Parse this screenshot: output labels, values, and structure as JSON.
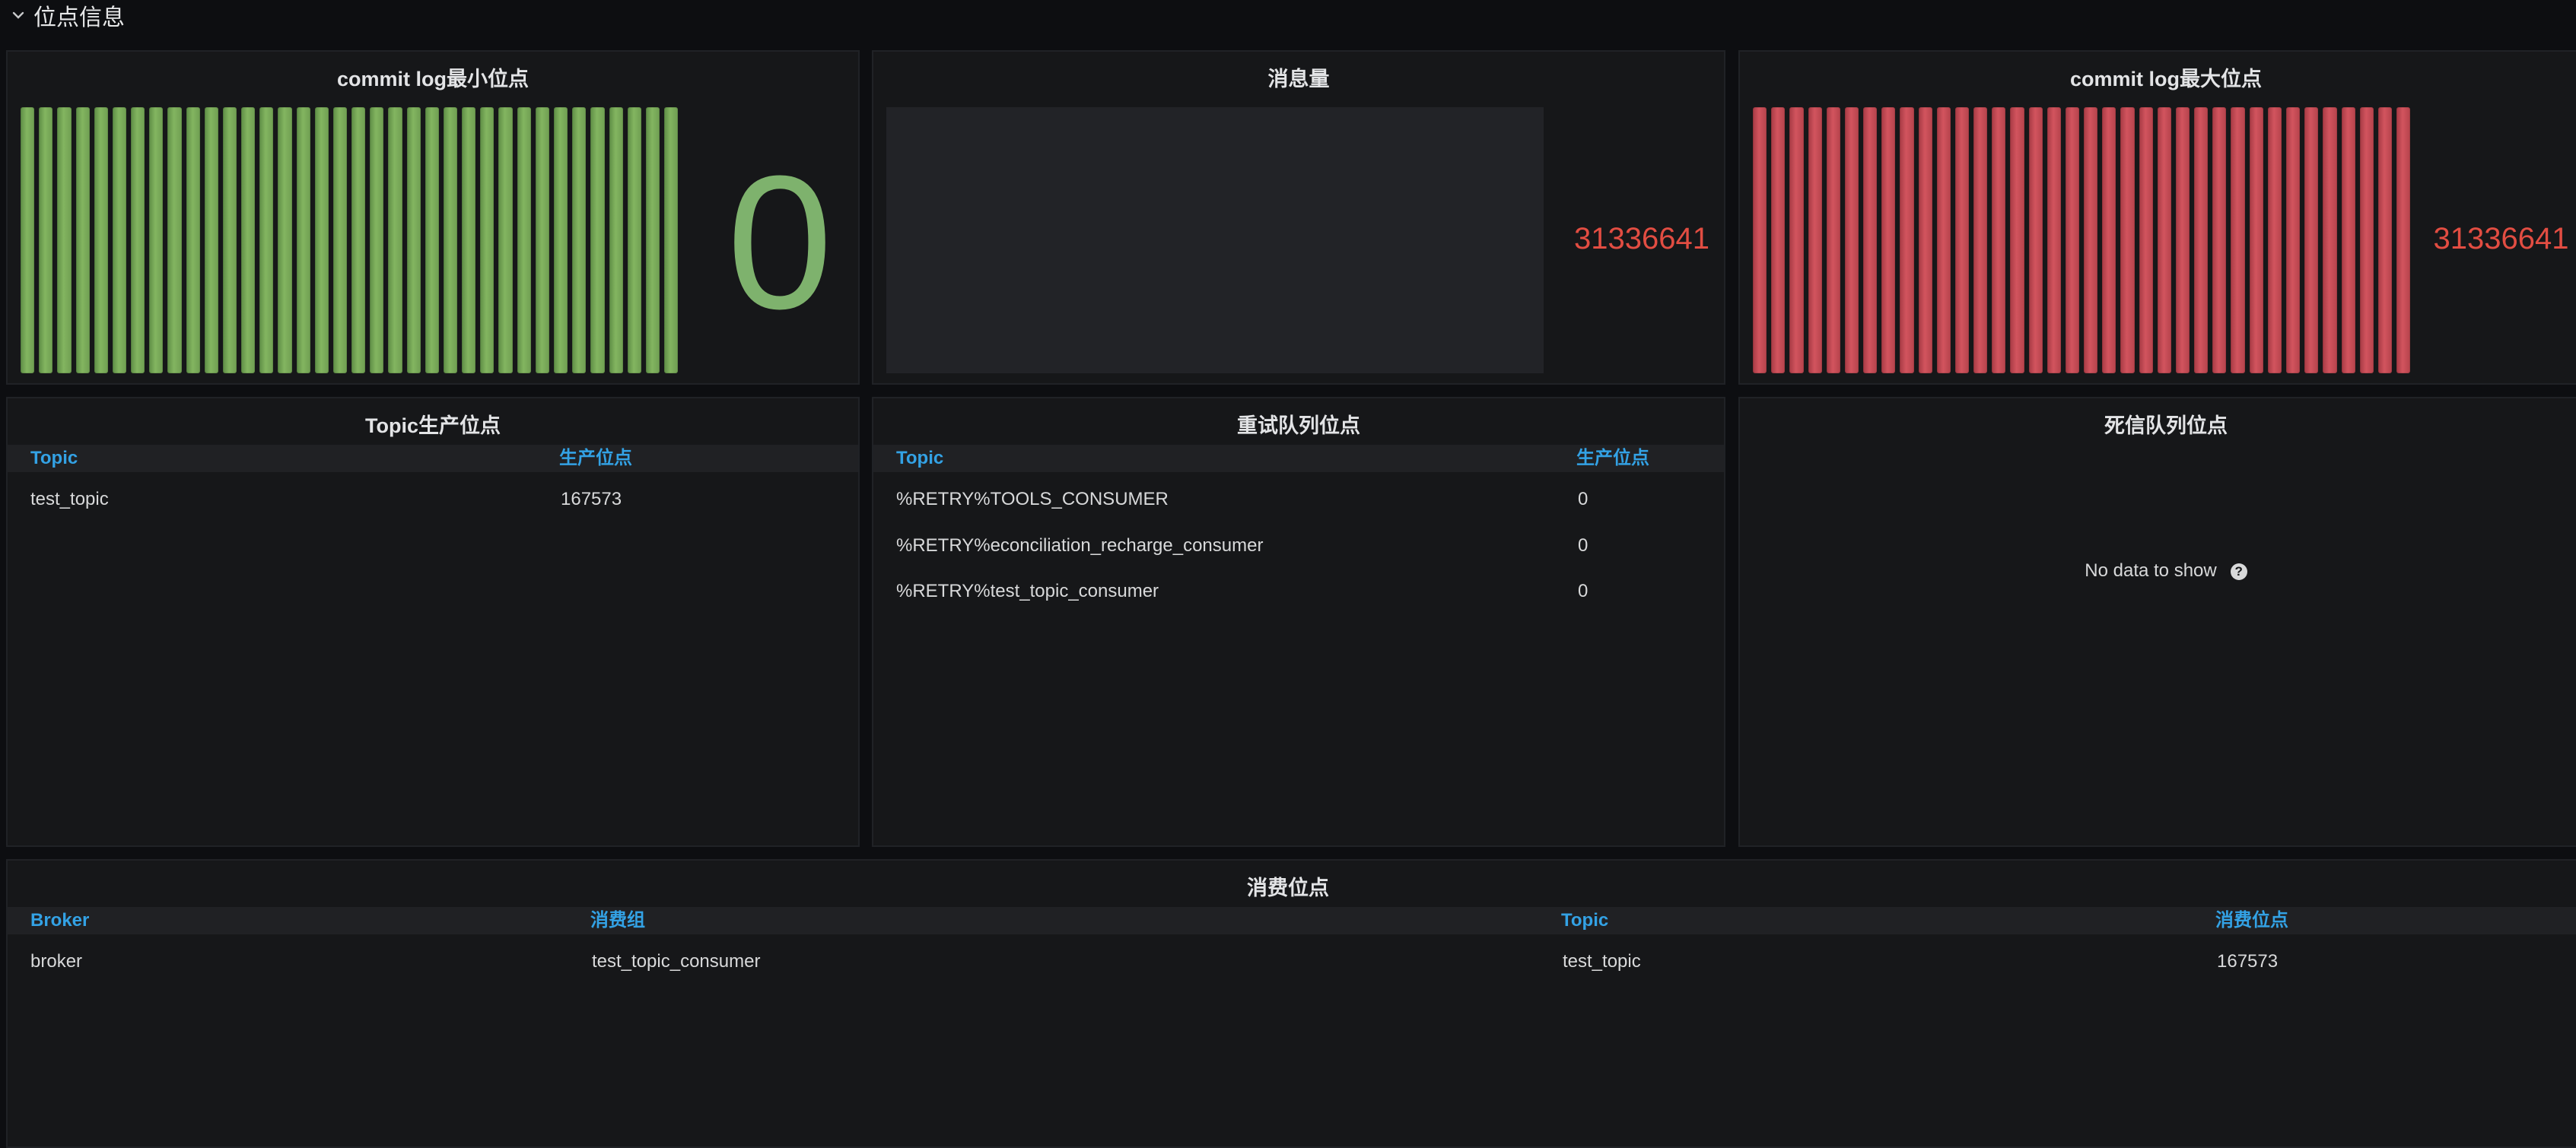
{
  "row": {
    "title": "位点信息"
  },
  "panels": {
    "min_offset": {
      "title": "commit log最小位点",
      "value": "0",
      "color": "#7eb26d"
    },
    "msg_count": {
      "title": "消息量",
      "value": "31336641",
      "color": "#e24d42"
    },
    "max_offset": {
      "title": "commit log最大位点",
      "value": "31336641",
      "color": "#e24d42"
    },
    "topic_produce": {
      "title": "Topic生产位点",
      "columns": [
        "Topic",
        "生产位点"
      ],
      "rows": [
        [
          "test_topic",
          "167573"
        ]
      ]
    },
    "retry_queue": {
      "title": "重试队列位点",
      "columns": [
        "Topic",
        "生产位点"
      ],
      "rows": [
        [
          "%RETRY%TOOLS_CONSUMER",
          "0"
        ],
        [
          "%RETRY%econciliation_recharge_consumer",
          "0"
        ],
        [
          "%RETRY%test_topic_consumer",
          "0"
        ]
      ]
    },
    "dead_letter": {
      "title": "死信队列位点",
      "no_data": "No data to show"
    },
    "consume_offset": {
      "title": "消费位点",
      "columns": [
        "Broker",
        "消费组",
        "Topic",
        "消费位点"
      ],
      "rows": [
        [
          "broker",
          "test_topic_consumer",
          "test_topic",
          "167573"
        ]
      ]
    }
  },
  "colors": {
    "header_text": "#33a2e5",
    "panel_bg": "#161719",
    "page_bg": "#0d0e11"
  },
  "icons": {
    "row_toggle": "chevron-down-icon",
    "help": "question-circle-icon"
  }
}
